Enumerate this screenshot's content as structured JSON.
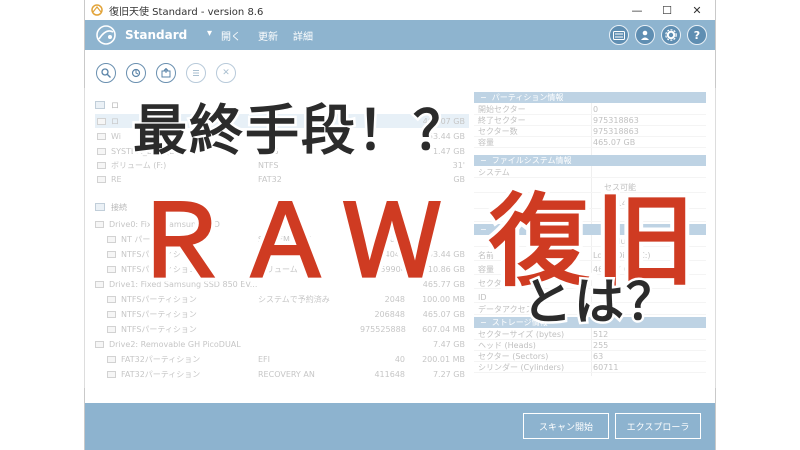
{
  "window": {
    "title": "復旧天使 Standard - version 8.6",
    "minimize_glyph": "—",
    "maximize_glyph": "☐",
    "close_glyph": "✕"
  },
  "header": {
    "mode": "Standard",
    "menu_arrow": "▾",
    "menu_open": "開く",
    "menu_update": "更新",
    "menu_details": "詳細",
    "buttons": [
      "keyboard-icon",
      "user-icon",
      "gear-icon",
      "help-icon"
    ],
    "help_glyph": "?"
  },
  "toolbar": {
    "icons": [
      "search-icon",
      "scan-icon",
      "export-icon",
      "list-icon",
      "close-icon"
    ],
    "close_glyph": "✕"
  },
  "left": {
    "group1_label": "ロ",
    "group2_label": "接続",
    "rows": [
      {
        "c1": "ロ",
        "c2": "",
        "c3": "",
        "c4": "465.07 GB"
      },
      {
        "c1": "Wi",
        "c2": "",
        "c3": "",
        "c4": "153.44 GB"
      },
      {
        "c1": "SYSTEM_DRV (E:)",
        "c2": "NTFS",
        "c3": "",
        "c4": "1.47 GB"
      },
      {
        "c1": "ボリューム (F:)",
        "c2": "NTFS",
        "c3": "",
        "c4": "31'"
      },
      {
        "c1": "RE",
        "c2": "FAT32",
        "c3": "",
        "c4": "GB"
      },
      {
        "c1": "Drive0: Fixed Samsung SSD",
        "c2": "",
        "c3": "",
        "c4": ""
      },
      {
        "c1": "NT  パーティション",
        "c2": "SYSTEM_DRV",
        "c3": "2048",
        "c4": ""
      },
      {
        "c1": "NTFSパーティション",
        "c2": "Windows7_OS",
        "c3": "3074048",
        "c4": "153.44 GB"
      },
      {
        "c1": "NTFSパーティション",
        "c2": "ボリューム",
        "c3": "324859904",
        "c4": "310.86 GB"
      },
      {
        "c1": "Drive1: Fixed Samsung SSD 850 EV...",
        "c2": "",
        "c3": "",
        "c4": "465.77 GB"
      },
      {
        "c1": "NTFSパーティション",
        "c2": "システムで予約済み",
        "c3": "2048",
        "c4": "100.00 MB"
      },
      {
        "c1": "NTFSパーティション",
        "c2": "",
        "c3": "206848",
        "c4": "465.07 GB"
      },
      {
        "c1": "NTFSパーティション",
        "c2": "",
        "c3": "975525888",
        "c4": "607.04 MB"
      },
      {
        "c1": "Drive2: Removable GH PicoDUAL",
        "c2": "",
        "c3": "",
        "c4": "7.47 GB"
      },
      {
        "c1": "FAT32パーティション",
        "c2": "EFI",
        "c3": "40",
        "c4": "200.01 MB"
      },
      {
        "c1": "FAT32パーティション",
        "c2": "RECOVERY AN",
        "c3": "411648",
        "c4": "7.27 GB"
      }
    ]
  },
  "right": {
    "section1": "パーティション情報",
    "p1": [
      {
        "k": "開始セクター",
        "v": "0"
      },
      {
        "k": "終了セクター",
        "v": "975318863"
      },
      {
        "k": "セクター数",
        "v": "975318863"
      },
      {
        "k": "容量",
        "v": "465.07 GB"
      }
    ],
    "section2": "ファイルシステム情報",
    "p2": [
      {
        "k": "システム",
        "v": ""
      },
      {
        "k": "",
        "v": "セス可能"
      },
      {
        "k": "",
        "v": "06 14.06.2017"
      },
      {
        "k": "ize",
        "v": ""
      }
    ],
    "section3": "",
    "p3": [
      {
        "k": "",
        "v": "l volume"
      },
      {
        "k": "名前",
        "v": "Local Disk (C:)"
      },
      {
        "k": "容量",
        "v": "465.07 GB"
      },
      {
        "k": "セクター数",
        "v": ""
      },
      {
        "k": "ID",
        "v": ""
      },
      {
        "k": "データアクセス",
        "v": ""
      }
    ],
    "section4": "ストレージ情報",
    "p4": [
      {
        "k": "セクターサイズ (bytes)",
        "v": "512"
      },
      {
        "k": "ヘッド (Heads)",
        "v": "255"
      },
      {
        "k": "セクター (Sectors)",
        "v": "63"
      },
      {
        "k": "シリンダー (Cylinders)",
        "v": "60711"
      }
    ]
  },
  "footer": {
    "scan_button": "スキャン開始",
    "explorer_button": "エクスプローラ"
  },
  "overlay": {
    "headline": "最終手段！？",
    "big": "ＲＡＷ 復旧",
    "sub": "とは？"
  },
  "colors": {
    "header_blue": "#8eb4cf",
    "footer_blue": "#8db3cf",
    "accent_red": "#cf3b22"
  }
}
